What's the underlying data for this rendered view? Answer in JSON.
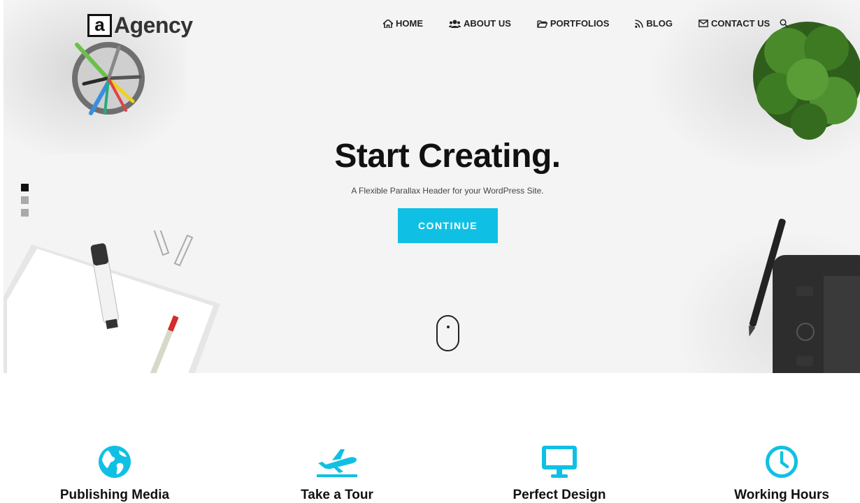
{
  "brand": {
    "mark": "a",
    "name": "Agency"
  },
  "nav": [
    {
      "label": "HOME",
      "icon": "home-icon"
    },
    {
      "label": "ABOUT US",
      "icon": "users-icon"
    },
    {
      "label": "PORTFOLIOS",
      "icon": "folder-icon"
    },
    {
      "label": "BLOG",
      "icon": "rss-icon"
    },
    {
      "label": "CONTACT US",
      "icon": "envelope-icon"
    }
  ],
  "hero": {
    "title": "Start Creating.",
    "subtitle": "A Flexible Parallax Header for your WordPress Site.",
    "cta": "CONTINUE",
    "slides": 3,
    "active_slide": 1
  },
  "features": [
    {
      "title": "Publishing Media",
      "icon": "globe-icon"
    },
    {
      "title": "Take a Tour",
      "icon": "airplane-icon"
    },
    {
      "title": "Perfect Design",
      "icon": "monitor-icon"
    },
    {
      "title": "Working Hours",
      "icon": "clock-icon"
    }
  ],
  "colors": {
    "accent": "#10c0e4",
    "text": "#111111",
    "hero_bg": "#f4f4f4"
  }
}
